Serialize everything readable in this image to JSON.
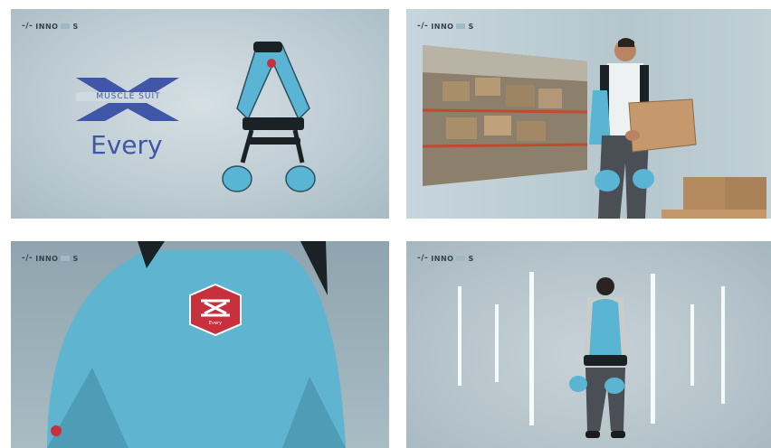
{
  "brand": {
    "part_a": "INNO",
    "part_b": "S",
    "mark": "-/-"
  },
  "product": {
    "logo_text": "MUSCLE SUIT",
    "name": "Every"
  },
  "badge": {
    "caption": "Every"
  },
  "colors": {
    "brand_blue": "#3f57a6",
    "suit_cyan": "#5ab5d4",
    "suit_dark": "#1b2226",
    "badge_red": "#c8303d"
  }
}
